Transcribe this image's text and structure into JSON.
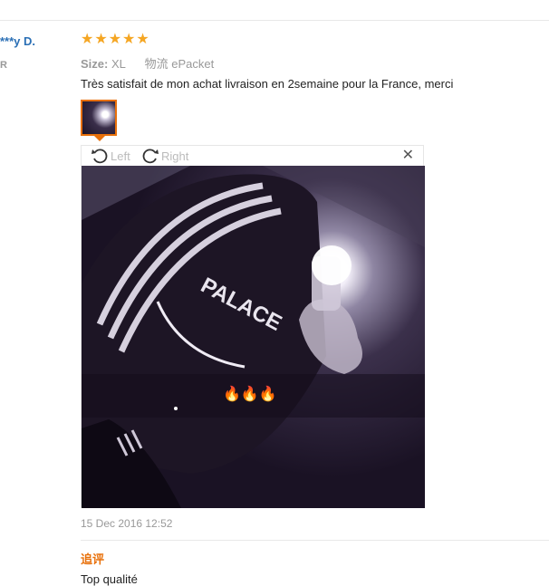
{
  "reviewer": {
    "name": "***y D.",
    "country": "R"
  },
  "rating": {
    "value": 5,
    "max": 5,
    "color": "#f5a623"
  },
  "attributes": {
    "size_label": "Size:",
    "size_value": "XL",
    "logistics_label": "物流",
    "logistics_value": "ePacket"
  },
  "review": {
    "text": "Très satisfait de mon achat livraison en 2semaine pour la France, merci",
    "date": "15 Dec 2016 12:52"
  },
  "viewer": {
    "rotate_left_label": "Left",
    "rotate_right_label": "Right",
    "close_glyph": "✕",
    "photo_emojis": "🔥🔥🔥",
    "photo_shirt_text": "PALACE"
  },
  "followup": {
    "label": "追评",
    "text": "Top qualité"
  },
  "colors": {
    "accent": "#e8700a",
    "link": "#2a6fb5",
    "muted": "#999999"
  }
}
